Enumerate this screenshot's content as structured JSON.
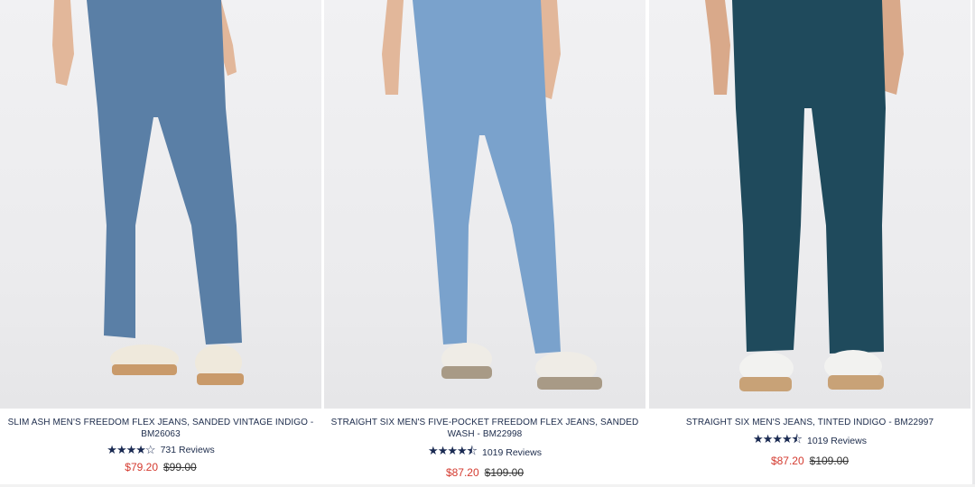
{
  "products": [
    {
      "title": "SLIM ASH MEN'S FREEDOM FLEX JEANS, SANDED VINTAGE INDIGO - BM26063",
      "stars": "★★★★☆",
      "reviews": "731 Reviews",
      "sale_price": "$79.20",
      "original_price": "$99.00",
      "denim_color": "#5a7fa6",
      "shoe_color": "#efe9dc",
      "sole_color": "#c99a6a"
    },
    {
      "title": "STRAIGHT SIX MEN'S FIVE-POCKET FREEDOM FLEX JEANS, SANDED WASH - BM22998",
      "stars": "★★★★⯪",
      "reviews": "1019 Reviews",
      "sale_price": "$87.20",
      "original_price": "$109.00",
      "denim_color": "#7aa2cc",
      "shoe_color": "#efece6",
      "sole_color": "#a89a86"
    },
    {
      "title": "STRAIGHT SIX MEN'S JEANS, TINTED INDIGO - BM22997",
      "stars": "★★★★⯪",
      "reviews": "1019 Reviews",
      "sale_price": "$87.20",
      "original_price": "$109.00",
      "denim_color": "#1f4a5c",
      "shoe_color": "#f2f2f0",
      "sole_color": "#c8a277"
    }
  ]
}
